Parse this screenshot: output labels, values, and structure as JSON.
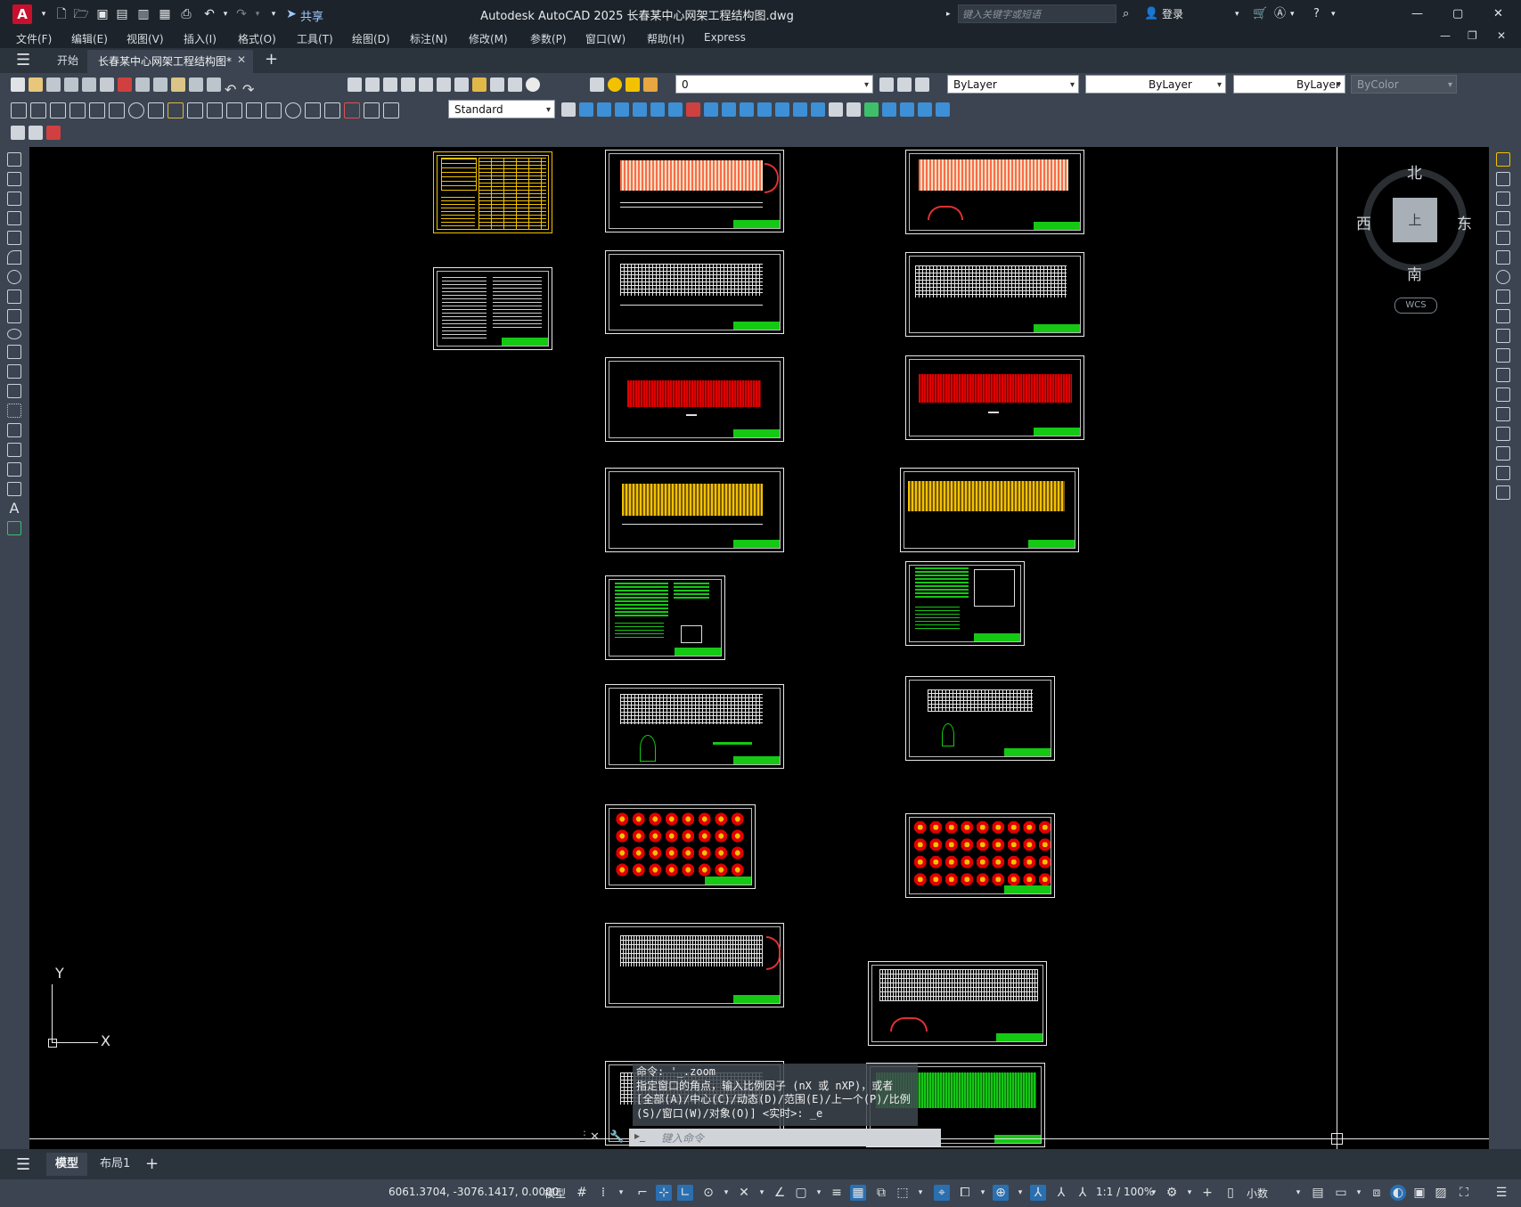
{
  "app": {
    "logo_letter": "A",
    "window_title": "Autodesk AutoCAD 2025    长春某中心网架工程结构图.dwg",
    "share_label": "共享",
    "search_placeholder": "键入关键字或短语",
    "login_label": "登录"
  },
  "menu": [
    "文件(F)",
    "编辑(E)",
    "视图(V)",
    "插入(I)",
    "格式(O)",
    "工具(T)",
    "绘图(D)",
    "标注(N)",
    "修改(M)",
    "参数(P)",
    "窗口(W)",
    "帮助(H)",
    "Express"
  ],
  "tabs": {
    "start": "开始",
    "document": "长春某中心网架工程结构图*"
  },
  "properties": {
    "layer": "0",
    "color": "ByLayer",
    "linetype": "ByLayer",
    "lineweight": "ByLayer",
    "plotstyle": "ByColor",
    "text_style": "Standard"
  },
  "viewcube": {
    "north": "北",
    "south": "南",
    "east": "东",
    "west": "西",
    "face": "上",
    "wcs": "WCS"
  },
  "ucs": {
    "x": "X",
    "y": "Y"
  },
  "command": {
    "history": [
      "命令: '_.zoom",
      "指定窗口的角点，输入比例因子 (nX 或 nXP)，或者",
      "[全部(A)/中心(C)/动态(D)/范围(E)/上一个(P)/比例",
      "(S)/窗口(W)/对象(O)] <实时>: _e"
    ],
    "input_placeholder": "键入命令"
  },
  "layout_tabs": {
    "model": "模型",
    "layout1": "布局1"
  },
  "status": {
    "coords": "6061.3704, -3076.1417, 0.0000",
    "model": "模型",
    "scale": "1:1 / 100%",
    "units": "小数"
  },
  "colors": {
    "sheet_border": "#e8e8e8",
    "title_block": "#14c814",
    "yellow": "#f2c200",
    "red": "#e10000",
    "accent": "#2a6fb0"
  }
}
